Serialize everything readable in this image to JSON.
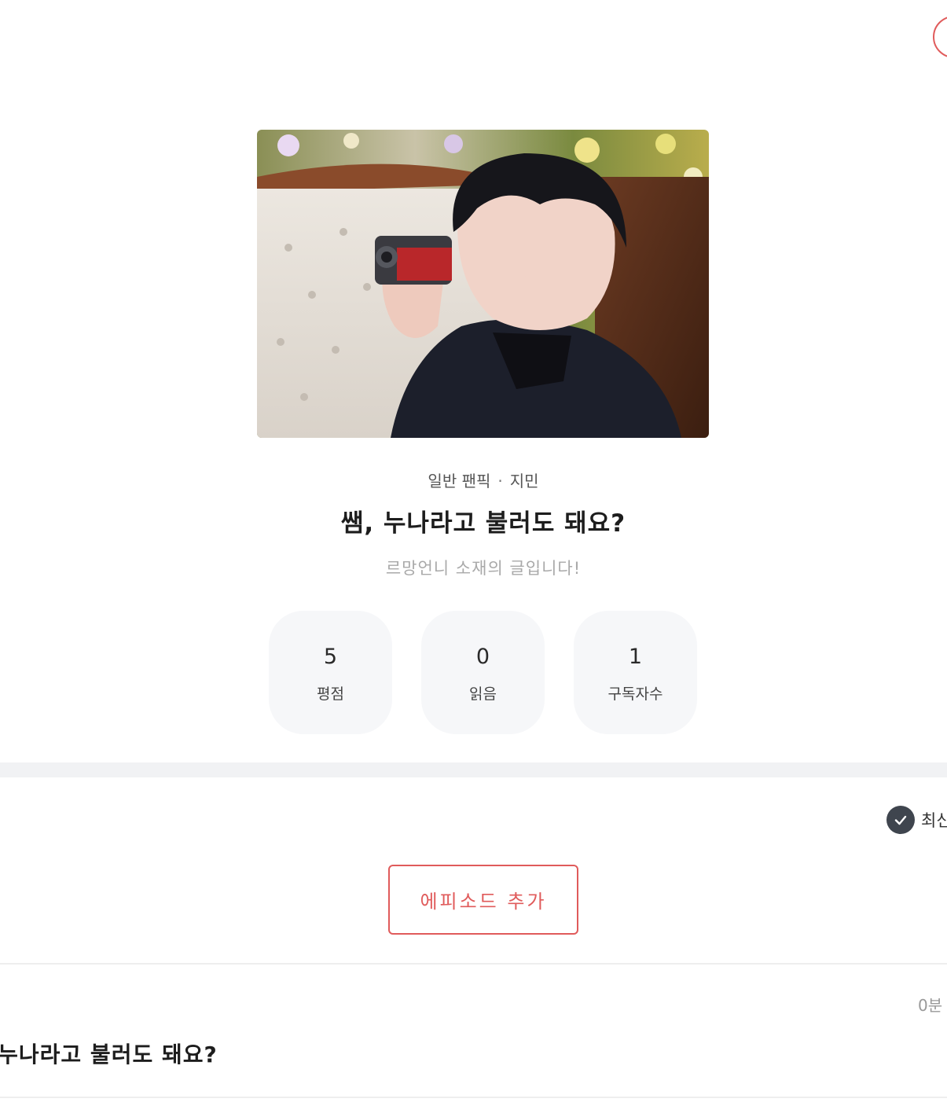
{
  "work": {
    "category": "일반 팬픽",
    "tag": "지민",
    "title": "쌤, 누나라고 불러도 돼요?",
    "description": "르망언니 소재의 글입니다!",
    "cover_icon": "cover-photo"
  },
  "stats": [
    {
      "value": "5",
      "label": "평점"
    },
    {
      "value": "0",
      "label": "읽음"
    },
    {
      "value": "1",
      "label": "구독자수"
    }
  ],
  "sort": {
    "label": "최신",
    "icon": "check-icon"
  },
  "actions": {
    "add_episode": "에피소드 추가"
  },
  "episodes": [
    {
      "time": "0분",
      "title": "쌤, 누나라고 불러도 돼요?"
    }
  ],
  "colors": {
    "accent": "#e05b5b",
    "card_bg": "#f6f7f9",
    "check_bg": "#3f454e"
  }
}
